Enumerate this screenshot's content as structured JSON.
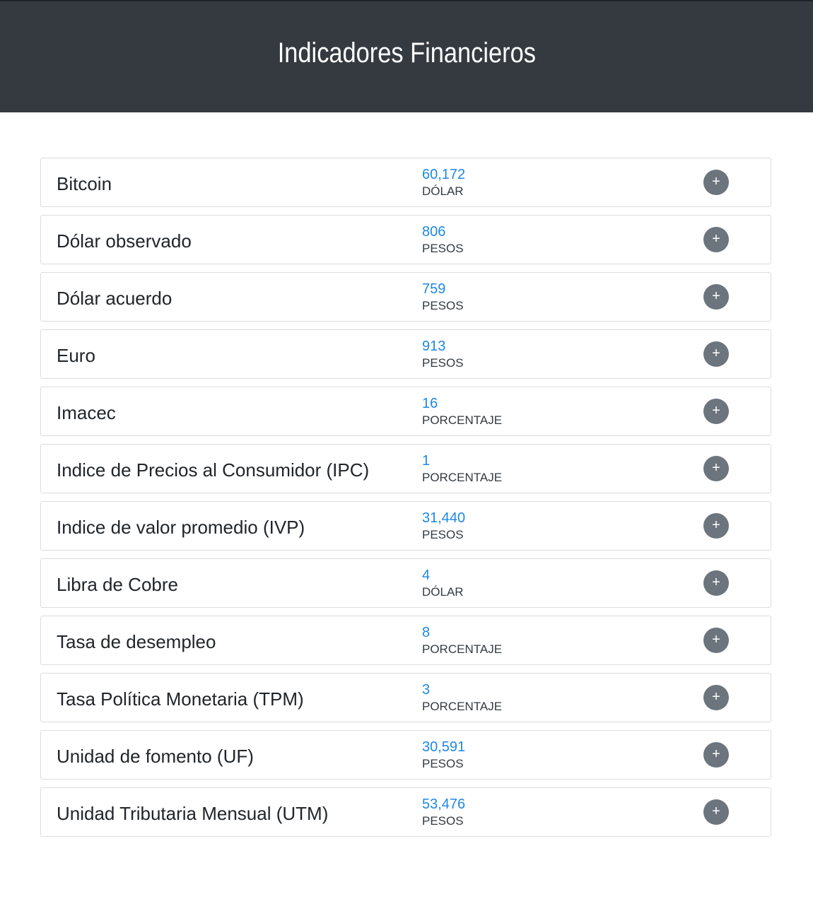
{
  "header": {
    "title": "Indicadores Financieros"
  },
  "indicators": [
    {
      "name": "Bitcoin",
      "value": "60,172",
      "unit": "DÓLAR"
    },
    {
      "name": "Dólar observado",
      "value": "806",
      "unit": "PESOS"
    },
    {
      "name": "Dólar acuerdo",
      "value": "759",
      "unit": "PESOS"
    },
    {
      "name": "Euro",
      "value": "913",
      "unit": "PESOS"
    },
    {
      "name": "Imacec",
      "value": "16",
      "unit": "PORCENTAJE"
    },
    {
      "name": "Indice de Precios al Consumidor (IPC)",
      "value": "1",
      "unit": "PORCENTAJE"
    },
    {
      "name": "Indice de valor promedio (IVP)",
      "value": "31,440",
      "unit": "PESOS"
    },
    {
      "name": "Libra de Cobre",
      "value": "4",
      "unit": "DÓLAR"
    },
    {
      "name": "Tasa de desempleo",
      "value": "8",
      "unit": "PORCENTAJE"
    },
    {
      "name": "Tasa Política Monetaria (TPM)",
      "value": "3",
      "unit": "PORCENTAJE"
    },
    {
      "name": "Unidad de fomento (UF)",
      "value": "30,591",
      "unit": "PESOS"
    },
    {
      "name": "Unidad Tributaria Mensual (UTM)",
      "value": "53,476",
      "unit": "PESOS"
    }
  ],
  "expand_button": {
    "label": "+",
    "icon": "plus-icon"
  },
  "colors": {
    "header_bg": "#343a40",
    "value_blue": "#1e88e5",
    "button_gray": "#6c757d"
  }
}
